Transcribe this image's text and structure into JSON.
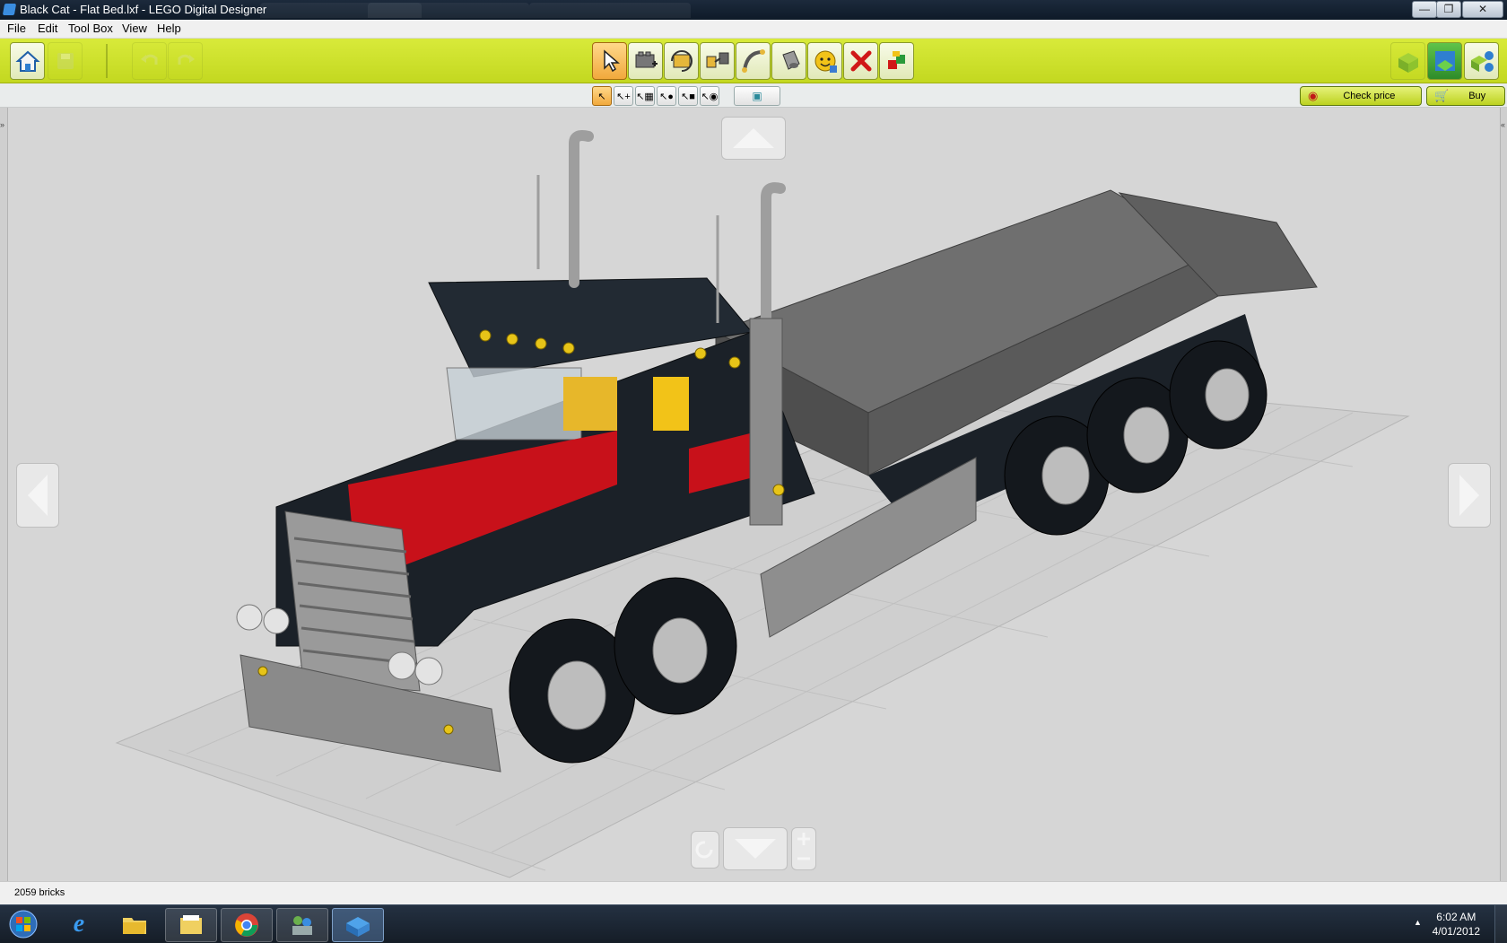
{
  "window": {
    "title": "Black Cat - Flat Bed.lxf - LEGO Digital Designer",
    "minimize_icon": "minimize-icon",
    "maximize_icon": "restore-icon",
    "close_icon": "close-icon"
  },
  "menu": {
    "items": [
      "File",
      "Edit",
      "Tool Box",
      "View",
      "Help"
    ]
  },
  "toolbar": {
    "left_buttons": [
      "home-icon",
      "save-icon",
      "undo-icon",
      "redo-icon"
    ],
    "tools": [
      "select-tool",
      "clone-tool",
      "hinge-tool",
      "hinge-align-tool",
      "flex-tool",
      "paint-tool",
      "decorate-tool",
      "delete-tool",
      "hide-tool"
    ],
    "active_tool": "select-tool",
    "modes": [
      "build-mode",
      "view-mode",
      "building-guide-mode"
    ]
  },
  "subtoolbar": {
    "select_modes": [
      "single-select",
      "multi-select",
      "connected-select",
      "color-select",
      "shape-select",
      "color-shape-select"
    ],
    "invert_selection": "invert-selection-icon",
    "check_price_label": "Check price",
    "buy_label": "Buy"
  },
  "status": {
    "brick_count": "2059 bricks"
  },
  "taskbar": {
    "apps": [
      "start-orb",
      "internet-explorer",
      "windows-explorer-folder",
      "file-manager",
      "chrome",
      "network-app",
      "lego-digital-designer"
    ],
    "time": "6:02 AM",
    "date": "4/01/2012"
  },
  "colors": {
    "toolbar_green": "#c8dc28",
    "canvas_bg": "#d6d6d6",
    "truck_black": "#1b2128",
    "truck_red": "#c8111a",
    "bed_gray": "#6e6e6e",
    "accent_yellow": "#f2c318"
  }
}
